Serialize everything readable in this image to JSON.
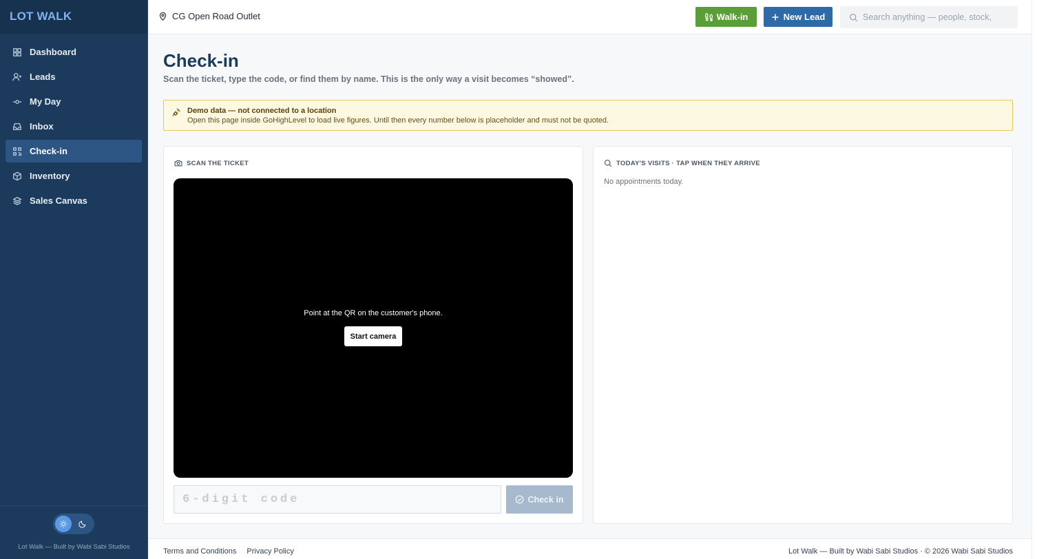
{
  "app": {
    "logo": "LOT WALK"
  },
  "sidebar": {
    "items": [
      {
        "label": "Dashboard",
        "icon": "grid-icon"
      },
      {
        "label": "Leads",
        "icon": "user-plus-icon"
      },
      {
        "label": "My Day",
        "icon": "commit-icon"
      },
      {
        "label": "Inbox",
        "icon": "inbox-icon"
      },
      {
        "label": "Check-in",
        "icon": "qr-icon",
        "active": true
      },
      {
        "label": "Inventory",
        "icon": "package-icon"
      },
      {
        "label": "Sales Canvas",
        "icon": "layers-icon"
      }
    ],
    "footer_credit": "Lot Walk — Built by Wabi Sabi Studios"
  },
  "topbar": {
    "location": "CG Open Road Outlet",
    "walkin_label": "Walk-in",
    "newlead_label": "New Lead",
    "search_placeholder": "Search anything — people, stock,"
  },
  "page": {
    "title": "Check-in",
    "subtitle": "Scan the ticket, type the code, or find them by name. This is the only way a visit becomes “showed”."
  },
  "banner": {
    "title": "Demo data — not connected to a location",
    "text": "Open this page inside GoHighLevel to load live figures. Until then every number below is placeholder and must not be quoted."
  },
  "scan_card": {
    "heading": "SCAN THE TICKET",
    "camera_prompt": "Point at the QR on the customer's phone.",
    "start_camera_label": "Start camera",
    "code_placeholder": "6-digit code",
    "checkin_label": "Check in"
  },
  "visits_card": {
    "heading": "TODAY'S VISITS · TAP WHEN THEY ARRIVE",
    "empty_text": "No appointments today."
  },
  "footer": {
    "terms": "Terms and Conditions",
    "privacy": "Privacy Policy",
    "copyright": "Lot Walk — Built by Wabi Sabi Studios · © 2026 Wabi Sabi Studios"
  },
  "colors": {
    "sidebar_bg": "#1b3a5c",
    "accent_green": "#5a9e37",
    "accent_blue": "#2f6aa8",
    "banner_bg": "#fdf8e1"
  }
}
